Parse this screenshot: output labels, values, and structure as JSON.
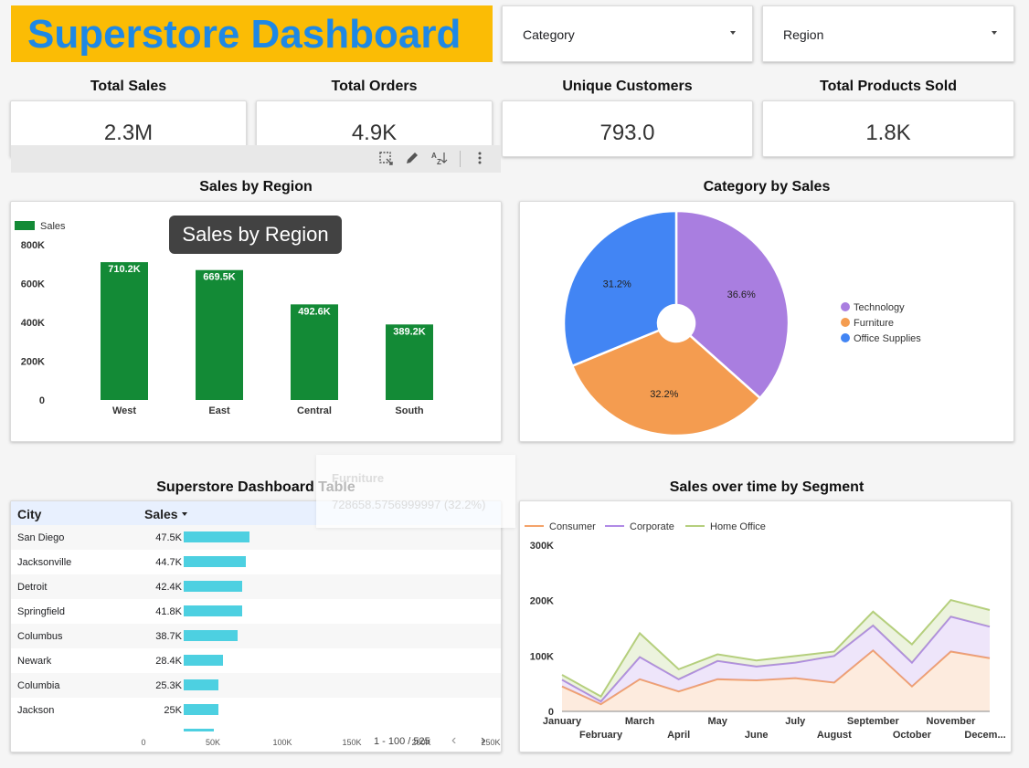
{
  "header": {
    "title": "Superstore Dashboard",
    "category_filter": "Category",
    "region_filter": "Region"
  },
  "kpis": [
    {
      "label": "Total Sales",
      "value": "2.3M"
    },
    {
      "label": "Total Orders",
      "value": "4.9K"
    },
    {
      "label": "Unique Customers",
      "value": "793.0"
    },
    {
      "label": "Total Products Sold",
      "value": "1.8K"
    }
  ],
  "colors": {
    "banner": "#fbbc05",
    "title": "#1e88e5",
    "bar": "#138a36",
    "table_bar": "#4dd0e1",
    "technology": "#a97ee0",
    "furniture": "#f49c50",
    "office_supplies": "#4285f4",
    "consumer": "#f4a36a",
    "corporate": "#b08ae6",
    "home_office": "#b5cf7d"
  },
  "toolbar": {
    "icons": [
      "select-area-icon",
      "pencil-icon",
      "sort-az-icon",
      "more-vert-icon"
    ]
  },
  "region_chart": {
    "title": "Sales by Region",
    "tooltip": "Sales by Region",
    "chart_data": {
      "type": "bar",
      "legend": "Sales",
      "legend_position": "top-left",
      "categories": [
        "West",
        "East",
        "Central",
        "South"
      ],
      "values": [
        710.2,
        669.5,
        492.6,
        389.2
      ],
      "labels": [
        "710.2K",
        "669.5K",
        "492.6K",
        "389.2K"
      ],
      "yticks": [
        "0",
        "200K",
        "400K",
        "600K",
        "800K"
      ],
      "ylim": [
        0,
        800
      ]
    }
  },
  "category_chart": {
    "title": "Category by Sales",
    "chart_data": {
      "type": "pie",
      "donut": true,
      "legend_position": "right",
      "slices": [
        {
          "name": "Technology",
          "value": 36.6,
          "label": "36.6%"
        },
        {
          "name": "Furniture",
          "value": 32.2,
          "label": "32.2%"
        },
        {
          "name": "Office Supplies",
          "value": 31.2,
          "label": "31.2%"
        }
      ]
    }
  },
  "ghost_tooltip": {
    "category": "Furniture",
    "value": "728658.5756999997 (32.2%)"
  },
  "table": {
    "title": "Superstore Dashboard Table",
    "col_city": "City",
    "col_sales": "Sales",
    "rows": [
      {
        "city": "San Diego",
        "sales": "47.5K",
        "value": 47.5
      },
      {
        "city": "Jacksonville",
        "sales": "44.7K",
        "value": 44.7
      },
      {
        "city": "Detroit",
        "sales": "42.4K",
        "value": 42.4
      },
      {
        "city": "Springfield",
        "sales": "41.8K",
        "value": 41.8
      },
      {
        "city": "Columbus",
        "sales": "38.7K",
        "value": 38.7
      },
      {
        "city": "Newark",
        "sales": "28.4K",
        "value": 28.4
      },
      {
        "city": "Columbia",
        "sales": "25.3K",
        "value": 25.3
      },
      {
        "city": "Jackson",
        "sales": "25K",
        "value": 25.0
      }
    ],
    "axis_ticks": [
      "0",
      "50K",
      "100K",
      "150K",
      "200K",
      "250K"
    ],
    "pagination": "1 - 100 / 525"
  },
  "segment_chart": {
    "title": "Sales over time by Segment",
    "chart_data": {
      "type": "area",
      "stacked": true,
      "legend_position": "top-left",
      "x": [
        "January",
        "February",
        "March",
        "April",
        "May",
        "June",
        "July",
        "August",
        "September",
        "October",
        "November",
        "December"
      ],
      "x_labels_top": [
        "January",
        "March",
        "May",
        "July",
        "September",
        "November"
      ],
      "x_labels_bottom": [
        "February",
        "April",
        "June",
        "August",
        "October",
        "Decem..."
      ],
      "yticks": [
        "0",
        "100K",
        "200K",
        "300K"
      ],
      "ylim": [
        0,
        300
      ],
      "series": [
        {
          "name": "Consumer",
          "values": [
            45,
            13,
            58,
            36,
            58,
            56,
            60,
            52,
            110,
            45,
            108,
            96
          ]
        },
        {
          "name": "Corporate",
          "values": [
            12,
            5,
            40,
            22,
            33,
            25,
            28,
            48,
            45,
            43,
            63,
            57
          ]
        },
        {
          "name": "Home Office",
          "values": [
            9,
            9,
            43,
            18,
            12,
            11,
            12,
            8,
            25,
            33,
            30,
            30
          ]
        }
      ]
    }
  }
}
